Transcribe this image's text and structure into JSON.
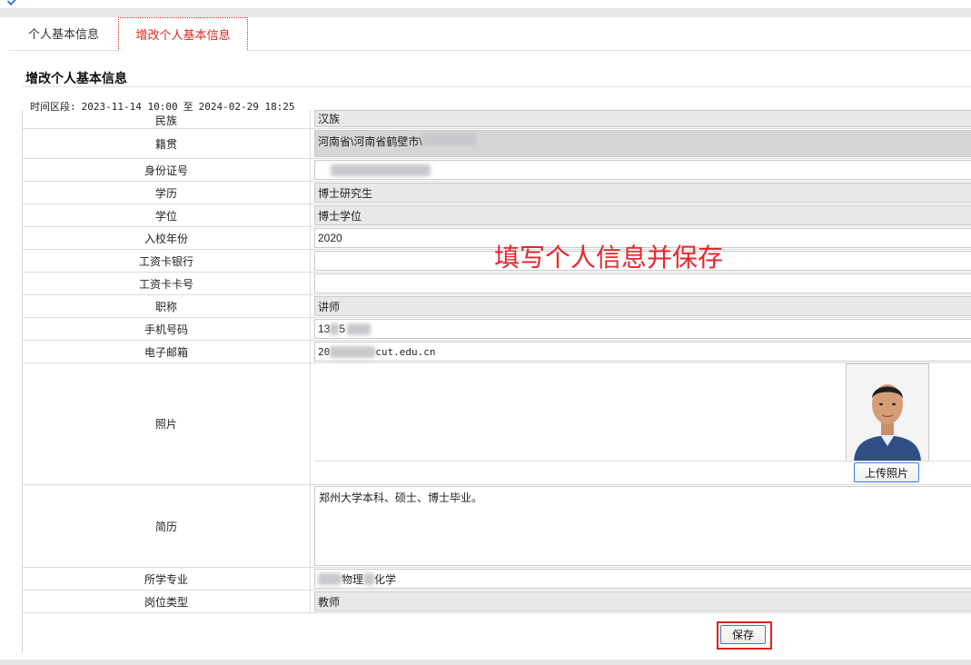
{
  "tabs": [
    {
      "label": "个人基本信息"
    },
    {
      "label": "增改个人基本信息"
    }
  ],
  "section_title": "增改个人基本信息",
  "period": {
    "label": "时间区段:",
    "start": "2023-11-14 10:00",
    "to": "至",
    "end": "2024-02-29 18:25"
  },
  "form": {
    "ethnicity": {
      "label": "民族",
      "value": "汉族"
    },
    "native_place": {
      "label": "籍贯",
      "value": "河南省\\河南省鹤壁市\\"
    },
    "id_number": {
      "label": "身份证号",
      "value": ""
    },
    "education": {
      "label": "学历",
      "value": "博士研究生"
    },
    "degree": {
      "label": "学位",
      "value": "博士学位"
    },
    "enroll_year": {
      "label": "入校年份",
      "value": "2020"
    },
    "salary_bank": {
      "label": "工资卡银行",
      "value": ""
    },
    "salary_card": {
      "label": "工资卡卡号",
      "value": ""
    },
    "title": {
      "label": "职称",
      "value": "讲师"
    },
    "phone": {
      "label": "手机号码",
      "value_prefix": "13",
      "value_mid": "5"
    },
    "email": {
      "label": "电子邮箱",
      "value_prefix": "20",
      "value_suffix": "cut.edu.cn"
    },
    "photo": {
      "label": "照片",
      "upload_label": "上传照片"
    },
    "resume": {
      "label": "简历",
      "value": "郑州大学本科、硕士、博士毕业。"
    },
    "major": {
      "label": "所学专业",
      "value_mid": "物理",
      "value_suffix": "化学"
    },
    "position_type": {
      "label": "岗位类型",
      "value": "教师"
    }
  },
  "overlay_text": "填写个人信息并保存",
  "save_label": "保存",
  "colors": {
    "accent_red": "#e0271e",
    "button_border": "#3a7bd5",
    "readonly_bg": "#e8e8e8"
  }
}
